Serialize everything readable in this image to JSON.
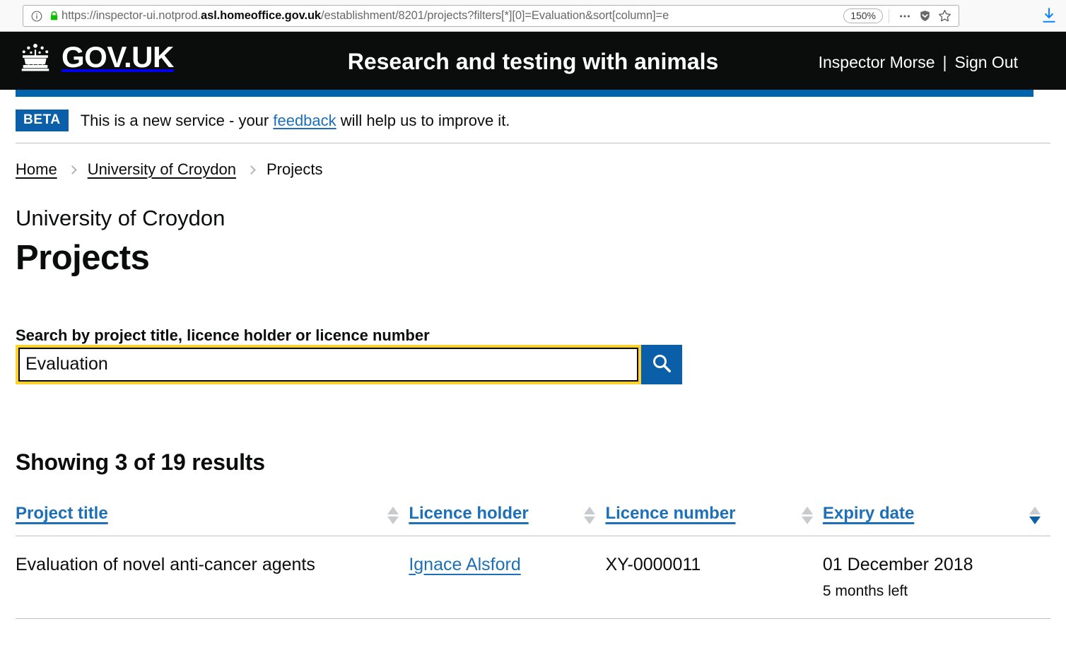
{
  "browser": {
    "url_prefix": "https://inspector-ui.notprod.",
    "url_host": "asl.homeoffice.gov.uk",
    "url_path": "/establishment/8201/projects?filters[*][0]=Evaluation&sort[column]=e",
    "zoom_level": "150%",
    "identity_icon": "info-circle-icon",
    "lock_icon": "padlock-icon",
    "menu_icon": "ellipsis-icon",
    "shield_icon": "shield-icon",
    "bookmark_icon": "star-icon",
    "download_icon": "download-arrow-icon"
  },
  "header": {
    "crown_icon": "crown-icon",
    "wordmark": "GOV.UK",
    "service_name": "Research and testing with animals",
    "user_name": "Inspector Morse",
    "separator": "|",
    "sign_out_label": "Sign Out"
  },
  "phase_banner": {
    "badge": "BETA",
    "text_before": "This is a new service - your ",
    "link": "feedback",
    "text_after": " will help us to improve it."
  },
  "breadcrumb": {
    "items": [
      {
        "label": "Home",
        "is_link": true
      },
      {
        "label": "University of Croydon",
        "is_link": true
      },
      {
        "label": "Projects",
        "is_link": false
      }
    ]
  },
  "page": {
    "caption": "University of Croydon",
    "title": "Projects"
  },
  "search": {
    "label": "Search by project title, licence holder or licence number",
    "value": "Evaluation",
    "placeholder": "",
    "button_icon": "search-icon",
    "focused": true
  },
  "results": {
    "count_text": "Showing 3 of 19 results",
    "columns": [
      {
        "label": "Project title",
        "sort": "none"
      },
      {
        "label": "Licence holder",
        "sort": "none"
      },
      {
        "label": "Licence number",
        "sort": "none"
      },
      {
        "label": "Expiry date",
        "sort": "desc"
      }
    ],
    "rows": [
      {
        "title": "Evaluation of novel anti-cancer agents",
        "holder": "Ignace Alsford",
        "number": "XY-0000011",
        "expiry_date": "01 December 2018",
        "expiry_remaining": "5 months left"
      }
    ]
  },
  "colors": {
    "govuk_black": "#0b0c0c",
    "govuk_blue": "#1d70b8",
    "accent_blue": "#0b5ea8",
    "focus_yellow": "#ffd130",
    "border_grey": "#bfc1c3"
  }
}
